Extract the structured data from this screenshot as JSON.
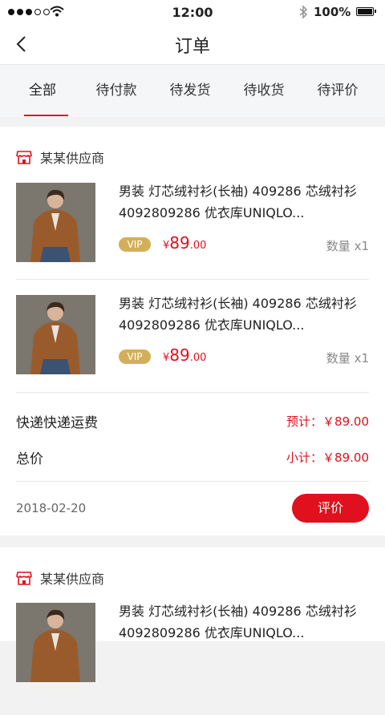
{
  "status": {
    "time": "12:00",
    "battery": "100%"
  },
  "header": {
    "title": "订单"
  },
  "tabs": [
    {
      "label": "全部"
    },
    {
      "label": "待付款"
    },
    {
      "label": "待发货"
    },
    {
      "label": "待收货"
    },
    {
      "label": "待评价"
    }
  ],
  "orders": [
    {
      "supplier": "某某供应商",
      "items": [
        {
          "line1": "男装 灯芯绒衬衫(长袖) 409286 芯绒衬衫",
          "line2": "4092809286 优衣库UNIQLO...",
          "vip": "VIP",
          "currency": "¥",
          "price_int": "89",
          "price_dec": ".00",
          "qty": "数量 x1"
        },
        {
          "line1": "男装 灯芯绒衬衫(长袖) 409286 芯绒衬衫",
          "line2": "4092809286 优衣库UNIQLO...",
          "vip": "VIP",
          "currency": "¥",
          "price_int": "89",
          "price_dec": ".00",
          "qty": "数量 x1"
        }
      ],
      "shipping_label": "快递快递运费",
      "shipping_value": "预计：￥89.00",
      "total_label": "总价",
      "total_value": "小计：￥89.00",
      "date": "2018-02-20",
      "action": "评价"
    },
    {
      "supplier": "某某供应商",
      "items": [
        {
          "line1": "男装 灯芯绒衬衫(长袖) 409286 芯绒衬衫",
          "line2": "4092809286 优衣库UNIQLO..."
        }
      ]
    }
  ],
  "colors": {
    "accent": "#e0101e",
    "vip": "#d4af5a",
    "tab_bg": "#f4f6f8"
  }
}
